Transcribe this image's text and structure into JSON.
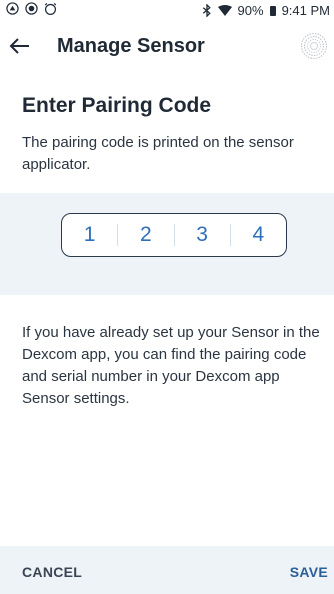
{
  "status_bar": {
    "bluetooth_icon": "bluetooth-icon",
    "wifi_icon": "wifi-icon",
    "battery_percent": "90%",
    "battery_icon": "battery-icon",
    "time": "9:41 PM"
  },
  "app_bar": {
    "back_icon": "back-arrow-icon",
    "title": "Manage Sensor",
    "sensor_icon": "sensor-icon"
  },
  "content": {
    "heading": "Enter Pairing Code",
    "subtext": "The pairing code is printed on the sensor applicator.",
    "pairing_code": [
      "1",
      "2",
      "3",
      "4"
    ],
    "info": "If you have already set up your Sensor in the Dexcom app, you can find the pairing code and serial number in your Dexcom app Sensor settings."
  },
  "actions": {
    "cancel": "CANCEL",
    "save": "SAVE"
  },
  "colors": {
    "accent": "#2e6fb7",
    "band": "#eef3f8",
    "text": "#1f2a36"
  }
}
